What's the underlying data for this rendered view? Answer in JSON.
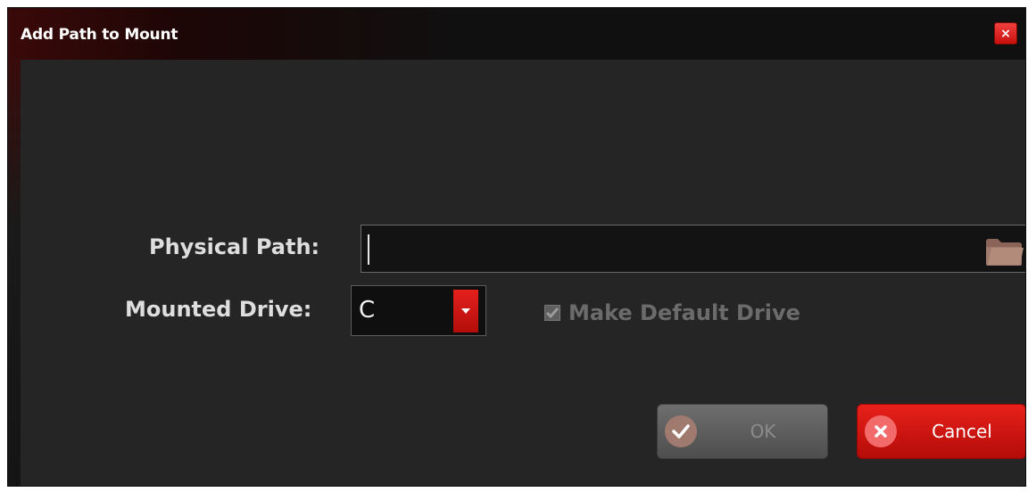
{
  "window": {
    "title": "Add Path to Mount",
    "close_label": "×"
  },
  "form": {
    "physical_path_label": "Physical Path:",
    "physical_path_value": "",
    "mounted_drive_label": "Mounted Drive:",
    "mounted_drive_value": "C",
    "make_default_label": "Make Default Drive",
    "make_default_checked": true,
    "make_default_enabled": false
  },
  "buttons": {
    "ok_label": "OK",
    "cancel_label": "Cancel"
  },
  "icons": {
    "close": "close-icon",
    "browse": "folder-icon",
    "dropdown": "caret-down-icon",
    "ok": "check-icon",
    "cancel": "x-icon"
  },
  "colors": {
    "accent": "#d81714",
    "background": "#252525",
    "titlebar": "#101010"
  }
}
